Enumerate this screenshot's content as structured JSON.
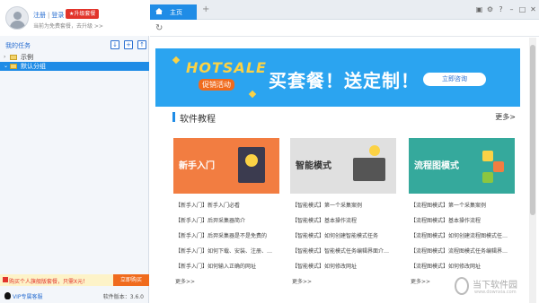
{
  "user": {
    "login": "注册",
    "sep": "|",
    "login2": "登录",
    "upgrade": "升级套餐",
    "tip": "当前为免费套餐，去升级 >>"
  },
  "tasks": {
    "title": "我的任务"
  },
  "tree": [
    {
      "label": "示例"
    },
    {
      "label": "默认分组"
    }
  ],
  "promo": {
    "text": "购买个人旗舰版套餐，只需X元！",
    "button": "立即购买"
  },
  "footer": {
    "vip": "VIP专属客服",
    "version": "软件版本：3.6.0"
  },
  "tabs": [
    {
      "label": "主页"
    }
  ],
  "banner": {
    "hotsale": "HOTSALE",
    "hotsale_sub": "促销活动",
    "slogan": "买套餐！送定制！",
    "button": "立即咨询"
  },
  "section": {
    "title": "软件教程",
    "more": "更多>"
  },
  "cards": [
    {
      "title": "新手入门",
      "links": [
        "【新手入门】新手入门必看",
        "【新手入门】后羿采集器简介",
        "【新手入门】后羿采集器是不是免费的",
        "【新手入门】如何下载、安装、注册、…",
        "【新手入门】如何输入正确的网址"
      ],
      "more": "更多>>"
    },
    {
      "title": "智能模式",
      "links": [
        "【智能模式】第一个采集案例",
        "【智能模式】基本操作流程",
        "【智能模式】如何创建智能模式任务",
        "【智能模式】智能模式任务编辑界面介…",
        "【智能模式】如何修改网址"
      ],
      "more": "更多>>"
    },
    {
      "title": "流程图模式",
      "links": [
        "【流程图模式】第一个采集案例",
        "【流程图模式】基本操作流程",
        "【流程图模式】如何创建流程图模式任…",
        "【流程图模式】流程图模式任务编辑界…",
        "【流程图模式】如何修改网址"
      ],
      "more": "更多>>"
    }
  ],
  "watermark": {
    "text": "当下软件园",
    "url": "www.downxia.com"
  },
  "colors": {
    "accent": "#1f8ce6",
    "banner": "#2ba4f0",
    "card1": "#f27d41",
    "card2": "#e0e0e0",
    "card3": "#35a99c"
  }
}
